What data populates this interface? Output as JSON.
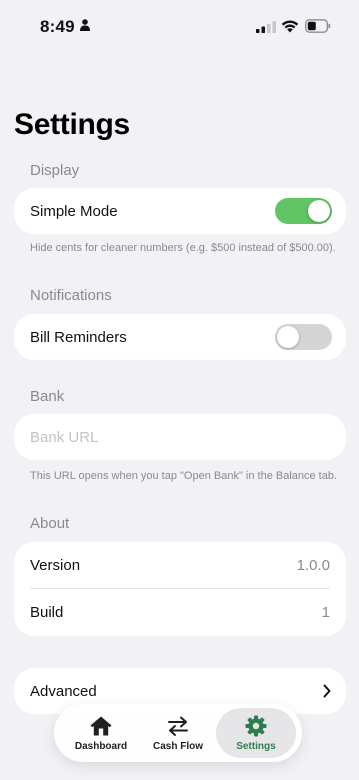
{
  "status_bar": {
    "time": "8:49"
  },
  "page": {
    "title": "Settings"
  },
  "colors": {
    "accent_green": "#61c465",
    "toggle_off": "#d5d5d8",
    "selected_tab_icon": "#2f7d4f"
  },
  "display": {
    "header": "Display",
    "simple_mode_label": "Simple Mode",
    "simple_mode_on": true,
    "footnote": "Hide cents for cleaner numbers (e.g. $500 instead of $500.00)."
  },
  "notifications": {
    "header": "Notifications",
    "bill_reminders_label": "Bill Reminders",
    "bill_reminders_on": false
  },
  "bank": {
    "header": "Bank",
    "url_value": "",
    "url_placeholder": "Bank URL",
    "footnote": "This URL opens when you tap \"Open Bank\" in the Balance tab."
  },
  "about": {
    "header": "About",
    "version_label": "Version",
    "version_value": "1.0.0",
    "build_label": "Build",
    "build_value": "1"
  },
  "advanced": {
    "label": "Advanced"
  },
  "tab_bar": {
    "tabs": [
      {
        "label": "Dashboard",
        "icon": "house-icon",
        "selected": false
      },
      {
        "label": "Cash Flow",
        "icon": "arrows-left-right-icon",
        "selected": false
      },
      {
        "label": "Settings",
        "icon": "gear-icon",
        "selected": true
      }
    ]
  }
}
